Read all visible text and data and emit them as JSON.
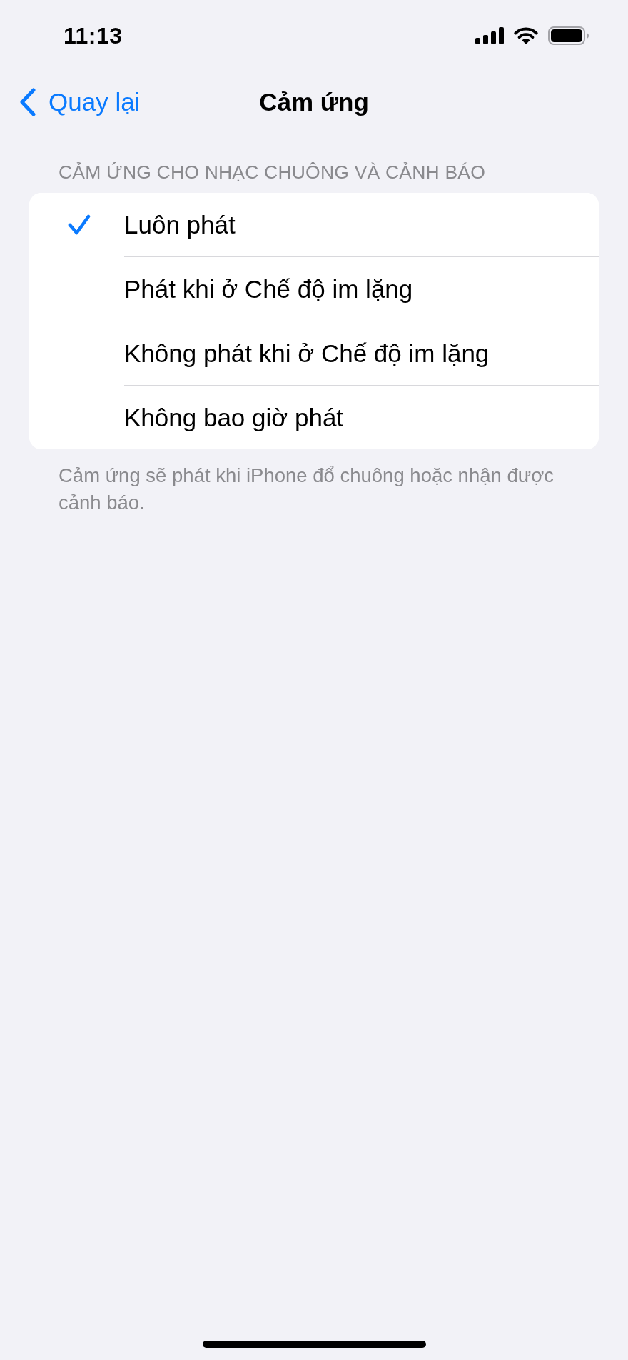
{
  "status_bar": {
    "time": "11:13"
  },
  "nav": {
    "back_label": "Quay lại",
    "title": "Cảm ứng"
  },
  "section": {
    "header": "CẢM ỨNG CHO NHẠC CHUÔNG VÀ CẢNH BÁO",
    "options": [
      {
        "label": "Luôn phát",
        "selected": true
      },
      {
        "label": "Phát khi ở Chế độ im lặng",
        "selected": false
      },
      {
        "label": "Không phát khi ở Chế độ im lặng",
        "selected": false
      },
      {
        "label": "Không bao giờ phát",
        "selected": false
      }
    ],
    "footer": "Cảm ứng sẽ phát khi iPhone đổ chuông hoặc nhận được cảnh báo."
  }
}
